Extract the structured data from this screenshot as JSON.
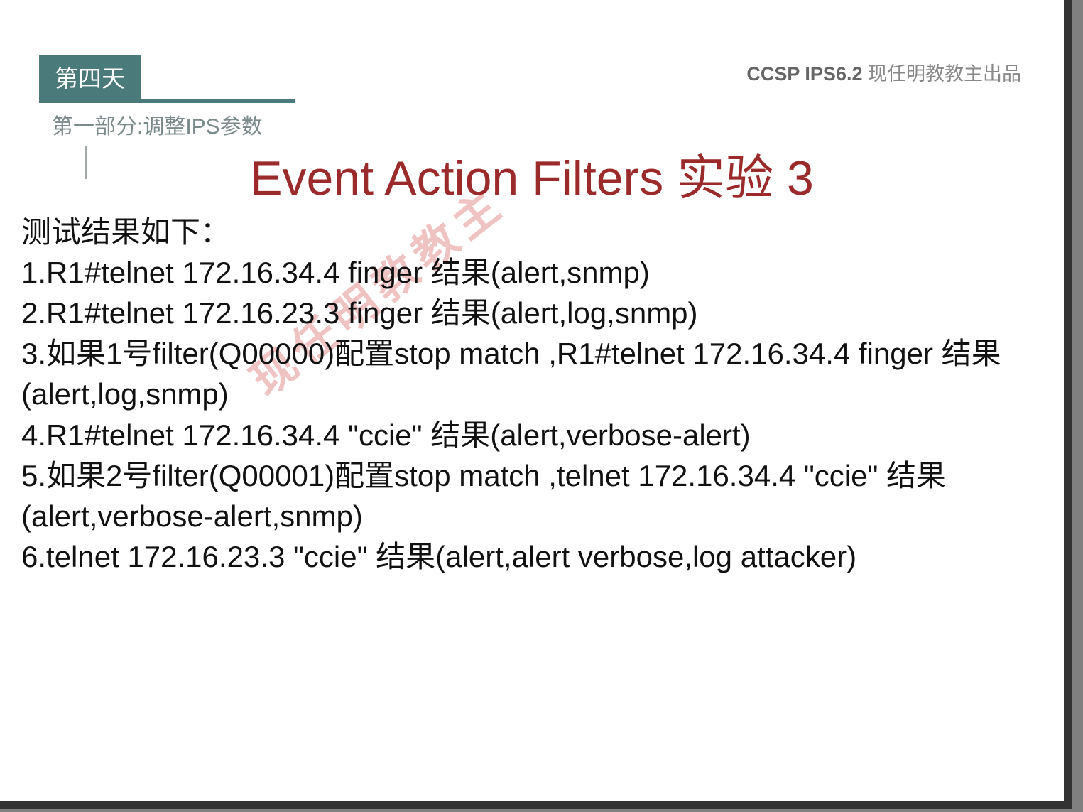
{
  "header": {
    "day": "第四天",
    "subtitle": "第一部分:调整IPS参数",
    "brand_bold": "CCSP IPS6.2",
    "brand_rest": "现任明教教主出品"
  },
  "title": "Event Action Filters 实验 3",
  "watermark": "现任明教教主",
  "body": {
    "intro": "测试结果如下：",
    "lines": [
      "1.R1#telnet 172.16.34.4 finger 结果(alert,snmp)",
      "2.R1#telnet 172.16.23.3 finger 结果(alert,log,snmp)",
      "3.如果1号filter(Q00000)配置stop match ,R1#telnet 172.16.34.4 finger 结果(alert,log,snmp)",
      "4.R1#telnet 172.16.34.4 \"ccie\" 结果(alert,verbose-alert)",
      "5.如果2号filter(Q00001)配置stop match ,telnet 172.16.34.4 \"ccie\" 结果(alert,verbose-alert,snmp)",
      "6.telnet 172.16.23.3 \"ccie\" 结果(alert,alert verbose,log attacker)"
    ]
  }
}
